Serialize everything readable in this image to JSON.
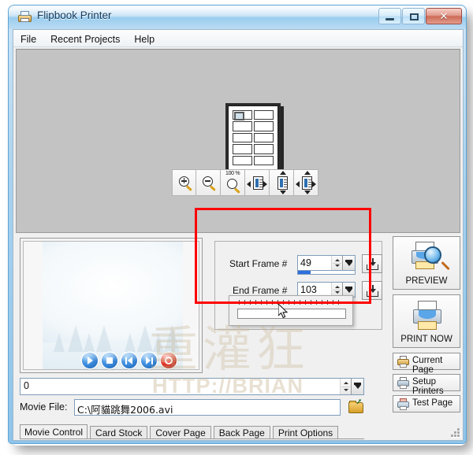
{
  "window": {
    "title": "Flipbook Printer",
    "app_icon": "printer-icon",
    "minimize_label": "",
    "maximize_label": "",
    "close_label": "✕"
  },
  "menu": {
    "items": [
      {
        "label": "File"
      },
      {
        "label": "Recent Projects"
      },
      {
        "label": "Help"
      }
    ]
  },
  "toolbar": {
    "buttons": [
      {
        "icon": "zoom-in-icon",
        "label": ""
      },
      {
        "icon": "zoom-out-icon",
        "label": ""
      },
      {
        "icon": "zoom-100-percent-icon",
        "label": "100 %"
      },
      {
        "icon": "fit-width-icon",
        "label": ""
      },
      {
        "icon": "fit-height-icon",
        "label": ""
      },
      {
        "icon": "fit-page-icon",
        "label": ""
      }
    ]
  },
  "frame_panel": {
    "start_frame": {
      "label": "Start Frame #",
      "value": "49",
      "progress_percent": 22
    },
    "end_frame": {
      "label": "End Frame #",
      "value": "103"
    },
    "set_start_button": "set-start-frame-button",
    "set_end_button": "set-end-frame-button",
    "slider": {
      "ticks": 19,
      "thumb_percent": 38
    }
  },
  "movie": {
    "position_value": "0",
    "file_label": "Movie File:",
    "file_value": "C:\\阿貓跳舞2006.avi",
    "browse_icon": "open-folder-icon",
    "playback": [
      {
        "name": "play-button",
        "icon": "play-icon"
      },
      {
        "name": "stop-button",
        "icon": "stop-icon"
      },
      {
        "name": "previous-button",
        "icon": "previous-icon"
      },
      {
        "name": "next-button",
        "icon": "next-icon"
      },
      {
        "name": "record-button",
        "icon": "record-icon"
      }
    ]
  },
  "tabs": [
    {
      "label": "Movie Control",
      "active": true
    },
    {
      "label": "Card Stock",
      "active": false
    },
    {
      "label": "Cover Page",
      "active": false
    },
    {
      "label": "Back Page",
      "active": false
    },
    {
      "label": "Print Options",
      "active": false
    }
  ],
  "right_panel": {
    "preview": {
      "label": "PREVIEW",
      "icon": "printer-preview-icon"
    },
    "print_now": {
      "label": "PRINT NOW",
      "icon": "printer-icon"
    },
    "current_page": {
      "label": "Current Page",
      "icon": "printer-small-icon"
    },
    "setup_printers": {
      "label": "Setup Printers",
      "icon": "printer-setup-icon"
    },
    "test_page": {
      "label": "Test Page",
      "icon": "printer-test-icon"
    }
  },
  "watermark": {
    "chinese": "重灌狂",
    "url": "HTTP://BRIAN"
  },
  "colors": {
    "annotation_red": "#ff0000",
    "progress_blue": "#2f6fe0",
    "title_blue": "#8ec4ea"
  }
}
